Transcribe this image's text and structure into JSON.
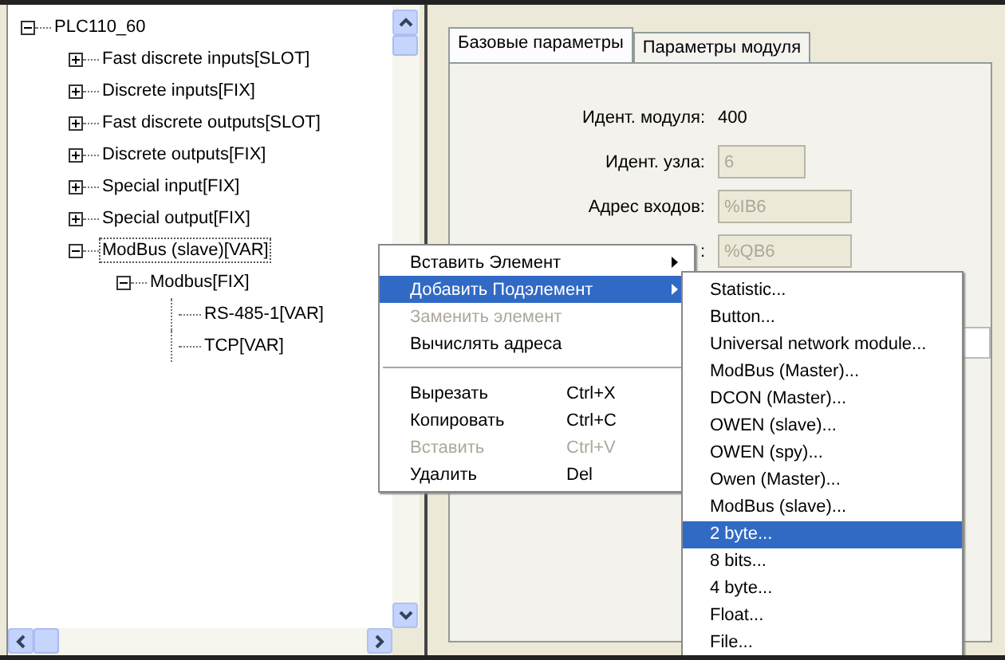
{
  "tree": [
    {
      "label": "PLC110_60",
      "expanded": true,
      "selected": false,
      "children": [
        {
          "label": "Fast discrete inputs[SLOT]",
          "expanded": false,
          "selected": false
        },
        {
          "label": "Discrete inputs[FIX]",
          "expanded": false,
          "selected": false
        },
        {
          "label": "Fast discrete outputs[SLOT]",
          "expanded": false,
          "selected": false
        },
        {
          "label": "Discrete outputs[FIX]",
          "expanded": false,
          "selected": false
        },
        {
          "label": "Special input[FIX]",
          "expanded": false,
          "selected": false
        },
        {
          "label": "Special output[FIX]",
          "expanded": false,
          "selected": false
        },
        {
          "label": "ModBus (slave)[VAR]",
          "expanded": true,
          "selected": true,
          "children": [
            {
              "label": "Modbus[FIX]",
              "expanded": true,
              "selected": false,
              "children": [
                {
                  "label": "RS-485-1[VAR]",
                  "selected": false
                },
                {
                  "label": "TCP[VAR]",
                  "selected": false
                }
              ]
            }
          ]
        }
      ]
    }
  ],
  "tabs": [
    {
      "label": "Базовые параметры",
      "selected": true
    },
    {
      "label": "Параметры модуля",
      "selected": false
    }
  ],
  "fields": [
    {
      "label": "Идент. модуля:",
      "value": "400",
      "kind": "text"
    },
    {
      "label": "Идент. узла:",
      "value": "6",
      "kind": "short-input"
    },
    {
      "label": "Адрес входов:",
      "value": "%IB6",
      "kind": "input"
    },
    {
      "label": ":",
      "value": "%QB6",
      "kind": "input"
    }
  ],
  "context_menu": [
    {
      "kind": "item",
      "label": "Вставить Элемент",
      "submenu": true,
      "disabled": false,
      "selected": false
    },
    {
      "kind": "item",
      "label": "Добавить Подэлемент",
      "submenu": true,
      "disabled": false,
      "selected": true
    },
    {
      "kind": "item",
      "label": "Заменить элемент",
      "submenu": false,
      "disabled": true,
      "selected": false
    },
    {
      "kind": "item",
      "label": "Вычислять адреса",
      "submenu": false,
      "disabled": false,
      "selected": false
    },
    {
      "kind": "separator"
    },
    {
      "kind": "item",
      "label": "Вырезать",
      "shortcut": "Ctrl+X",
      "submenu": false,
      "disabled": false,
      "selected": false
    },
    {
      "kind": "item",
      "label": "Копировать",
      "shortcut": "Ctrl+C",
      "submenu": false,
      "disabled": false,
      "selected": false
    },
    {
      "kind": "item",
      "label": "Вставить",
      "shortcut": "Ctrl+V",
      "submenu": false,
      "disabled": true,
      "selected": false
    },
    {
      "kind": "item",
      "label": "Удалить",
      "shortcut": "Del",
      "submenu": false,
      "disabled": false,
      "selected": false
    }
  ],
  "submenu": [
    {
      "label": "Statistic...",
      "selected": false
    },
    {
      "label": "Button...",
      "selected": false
    },
    {
      "label": "Universal network module...",
      "selected": false
    },
    {
      "label": "ModBus (Master)...",
      "selected": false
    },
    {
      "label": "DCON (Master)...",
      "selected": false
    },
    {
      "label": "OWEN (slave)...",
      "selected": false
    },
    {
      "label": "OWEN (spy)...",
      "selected": false
    },
    {
      "label": "Owen (Master)...",
      "selected": false
    },
    {
      "label": "ModBus (slave)...",
      "selected": false
    },
    {
      "label": "2 byte...",
      "selected": true
    },
    {
      "label": "8 bits...",
      "selected": false
    },
    {
      "label": "4 byte...",
      "selected": false
    },
    {
      "label": "Float...",
      "selected": false
    },
    {
      "label": "File...",
      "selected": false
    }
  ]
}
